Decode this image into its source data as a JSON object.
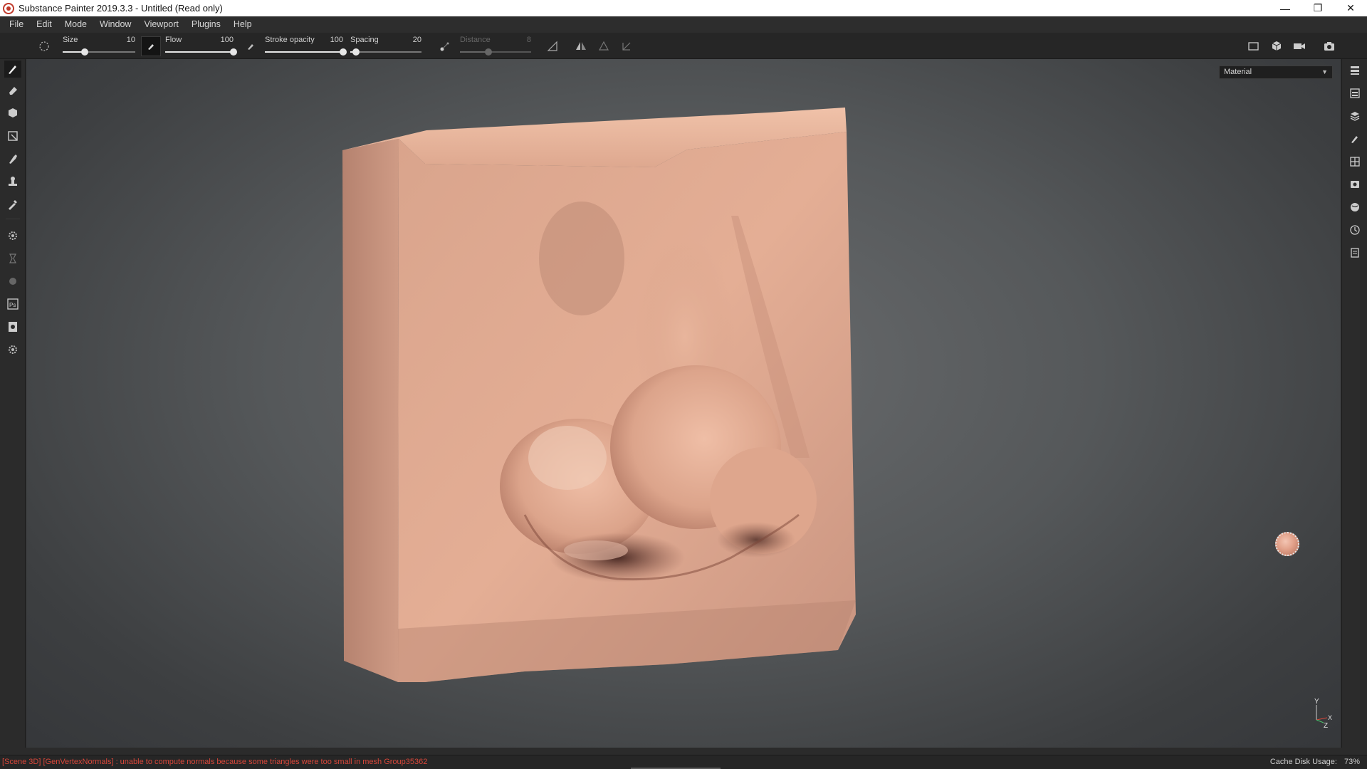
{
  "window": {
    "title": "Substance Painter 2019.3.3 - Untitled (Read only)",
    "controls": [
      "minimize",
      "restore",
      "close"
    ]
  },
  "menu": [
    "File",
    "Edit",
    "Mode",
    "Window",
    "Viewport",
    "Plugins",
    "Help"
  ],
  "tool_options": {
    "size": {
      "label": "Size",
      "value": "10",
      "fraction": 0.3
    },
    "flow": {
      "label": "Flow",
      "value": "100",
      "fraction": 1.0
    },
    "stroke_opacity": {
      "label": "Stroke opacity",
      "value": "100",
      "fraction": 1.0
    },
    "spacing": {
      "label": "Spacing",
      "value": "20",
      "fraction": 0.08
    },
    "distance": {
      "label": "Distance",
      "value": "8",
      "fraction": 0.4,
      "enabled": false
    }
  },
  "left_tools": [
    "paint-brush-icon",
    "eraser-icon",
    "projection-icon",
    "polygon-fill-icon",
    "smudge-icon",
    "clone-stamp-icon",
    "color-picker-icon",
    "settings-icon",
    "bake-icon",
    "iray-icon",
    "photoshop-icon",
    "export-icon",
    "plugin-settings-icon"
  ],
  "right_dock": [
    "layers-list-icon",
    "texture-set-icon",
    "layers-icon",
    "properties-icon",
    "display-settings-icon",
    "viewer-settings-icon",
    "shelf-icon",
    "history-icon",
    "log-icon"
  ],
  "viewport": {
    "channel": "Material",
    "axis": {
      "y": "Y",
      "z": "Z",
      "x": "X"
    }
  },
  "status": {
    "message": "[Scene 3D] [GenVertexNormals] : unable to compute normals because some triangles were too small in mesh Group35362",
    "cache_label": "Cache Disk Usage:",
    "cache_value": "73%"
  },
  "colors": {
    "skin": "#e3ad93",
    "error": "#d9473a",
    "panel": "#2b2b2b"
  }
}
